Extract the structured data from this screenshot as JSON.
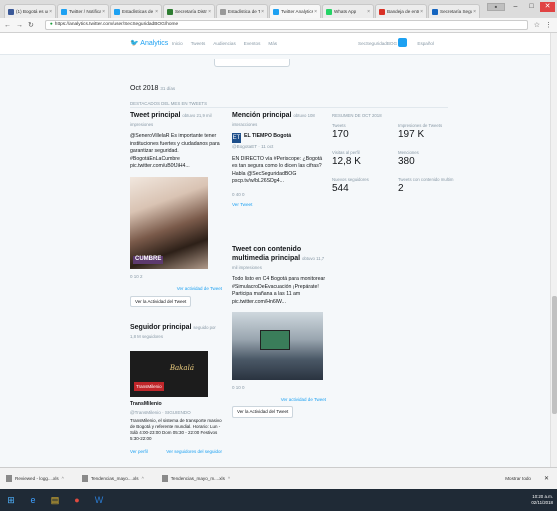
{
  "browser": {
    "tabs": [
      {
        "label": "(1) Bogotá es una n",
        "color": "#3b5998"
      },
      {
        "label": "Twitter / Notificac",
        "color": "#1da1f2"
      },
      {
        "label": "Estadísticas de Tw",
        "color": "#1da1f2"
      },
      {
        "label": "Secretaría Distrital",
        "color": "#2e7d32"
      },
      {
        "label": "Estadística de Tw",
        "color": "#999999"
      },
      {
        "label": "Twitter Analytics",
        "color": "#1da1f2",
        "active": true
      },
      {
        "label": "Whats App",
        "color": "#25d366"
      },
      {
        "label": "Bandeja de entrada",
        "color": "#d93025"
      },
      {
        "label": "Secretaría Seguri",
        "color": "#1565c0"
      }
    ],
    "address": "https://analytics.twitter.com/user/SecSeguridadBOG/home",
    "window_controls": {
      "minimize": "–",
      "maximize": "□",
      "close": "✕"
    }
  },
  "twitter_nav": {
    "logo": "Analytics",
    "menu": [
      "Inicio",
      "Tweets",
      "Audiencias",
      "Eventos",
      "Más"
    ],
    "period": "SecSeguridadBOG",
    "user": "Español"
  },
  "month_block": {
    "title": "Oct 2018",
    "days": "31 días",
    "summary_label": "DESTACADOS DEL MES EN TWEETS"
  },
  "top_tweet": {
    "heading": "Tweet principal",
    "subheading": "obtuvo 21,9 mil impresiones",
    "text": "@SeneroVillelaR Es importante tener instituciones fuertes y ciudadanos para garantizar seguridad. #BogotáEnLaCumbre pic.twitter.com/uB0fJiH4...",
    "image_label": "CUMBRE",
    "actions": "0  10  2",
    "view_activity_link": "Ver actividad de Tweet",
    "view_activity_button": "Ver la Actividad del Tweet"
  },
  "top_mention": {
    "heading": "Mención principal",
    "subheading": "obtuvo 108 interacciones",
    "account_name": "EL TIEMPO Bogotá",
    "account_handle": "@BogotaET · 11 oct",
    "account_logo": "ET",
    "text": "EN DIRECTO vía #Periscope: ¿Bogotá es tan segura como lo dicen las cifras? Habla @SecSeguridadBOG pscp.tv/w/bL26SDg4...",
    "actions": "0  40  0",
    "view_tweet": "Ver Tweet"
  },
  "top_follower": {
    "heading": "Seguidor principal",
    "subheading": "seguido por 1,8 M seguidores",
    "image_text": "TransMilenio",
    "image_script": "Bakalá",
    "name": "TransMilenio",
    "handle": "@TransMilenio · SIGUIENDO",
    "bio": "TransMilenio, el sistema de transporte masivo de Bogotá y referente mundial. Horario: Lun - Sáb 4:00-23:00 Dom 05:30 - 22:00 Festivos 5:30-22:00",
    "view_profile": "Ver perfil",
    "view_following": "Ver seguidores del seguidor"
  },
  "media_tweet": {
    "heading": "Tweet con contenido multimedia principal",
    "subheading": "obtuvo 11,7 mil impresiones",
    "text": "Todo listo en C4 Bogotá para monitorear #SimulacroDeEvacuación ¡Prepárate! Participa mañana a las 11 am pic.twitter.com/Hn6lW...",
    "actions": "0  10  0",
    "view_activity_link": "Ver actividad de Tweet",
    "view_activity_button": "Ver la Actividad del Tweet"
  },
  "stats": {
    "title": "RESUMEN DE OCT 2018",
    "items": [
      {
        "label": "Tweets",
        "value": "170"
      },
      {
        "label": "Impresiones de Tweets",
        "value": "197 K"
      },
      {
        "label": "Visitas al perfil",
        "value": "12,8 K"
      },
      {
        "label": "Menciones",
        "value": "380"
      },
      {
        "label": "Nuevos seguidores",
        "value": "544"
      },
      {
        "label": "Tweets con contenido multim",
        "value": "2"
      }
    ]
  },
  "downloads": {
    "items": [
      "Reviewed - logg....xls",
      "Tendencias_mayo....xls",
      "Tendencias_mayo_m....xls"
    ],
    "show_all": "Mostrar todo",
    "close": "✕"
  },
  "taskbar": {
    "time": "10:20 a.m.",
    "date": "02/11/2018"
  }
}
